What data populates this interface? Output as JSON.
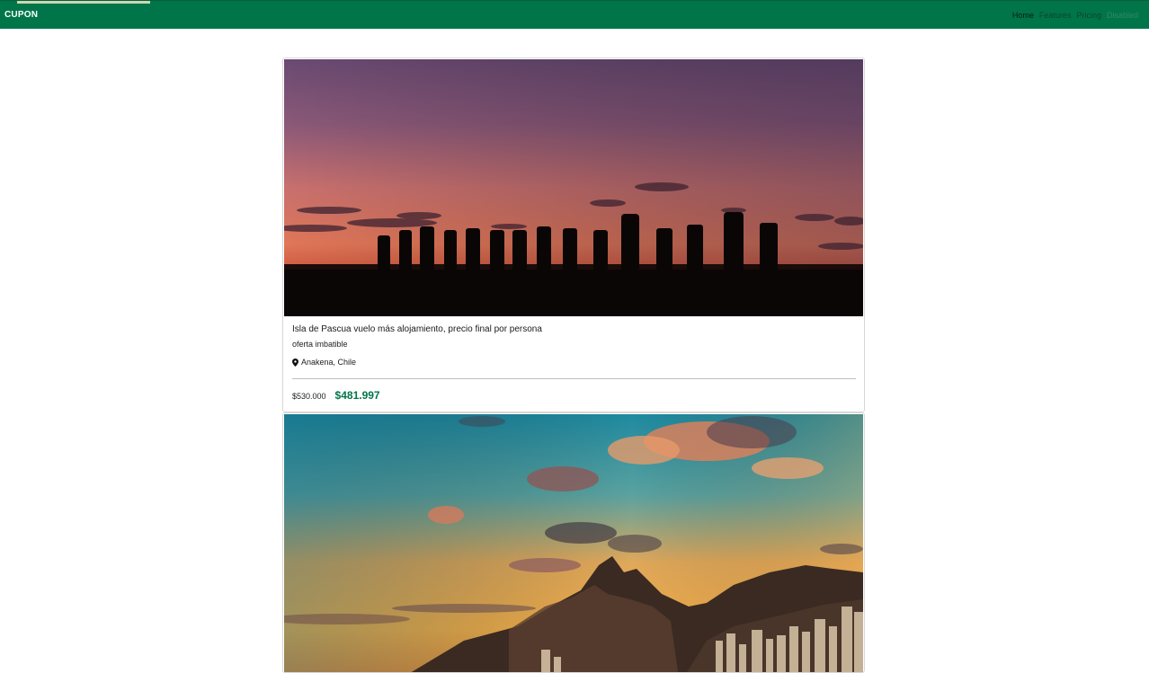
{
  "header": {
    "brand": "CUPON",
    "nav": [
      {
        "label": "Home",
        "state": "active"
      },
      {
        "label": "Features",
        "state": "normal"
      },
      {
        "label": "Pricing",
        "state": "normal"
      },
      {
        "label": "Disabled",
        "state": "disabled"
      }
    ],
    "colors": {
      "bar": "#00754a",
      "price": "#00754a"
    }
  },
  "offers": [
    {
      "title": "Isla de Pascua vuelo más alojamiento, precio final por persona",
      "subtitle": "oferta imbatible",
      "location_icon": "map-pin-icon",
      "location": "Anakena, Chile",
      "old_price": "$530.000",
      "new_price": "$481.997"
    }
  ]
}
